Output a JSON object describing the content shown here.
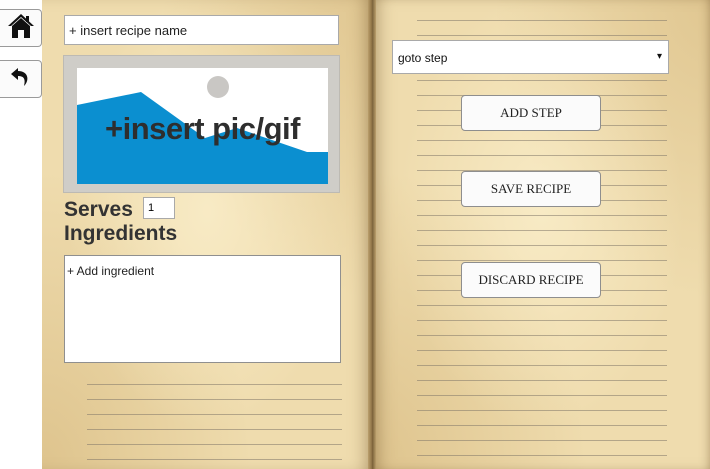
{
  "nav": {
    "home_icon": "home-icon",
    "back_icon": "undo-arrow-icon"
  },
  "recipe": {
    "name_placeholder": "+ insert recipe name",
    "picture_label": "+insert pic/gif",
    "serves_label": "Serves",
    "serves_value": "1",
    "ingredients_label": "Ingredients",
    "ingredient_placeholder": "+ Add ingredient"
  },
  "steps": {
    "goto_selected": "goto step",
    "dropdown_arrow": "▾"
  },
  "actions": {
    "add_step": "ADD STEP",
    "save": "SAVE RECIPE",
    "discard": "DISCARD RECIPE"
  },
  "colors": {
    "page": "#efdcae",
    "picture_blue": "#0b8fd0",
    "picture_sun": "#c9c7c4"
  }
}
